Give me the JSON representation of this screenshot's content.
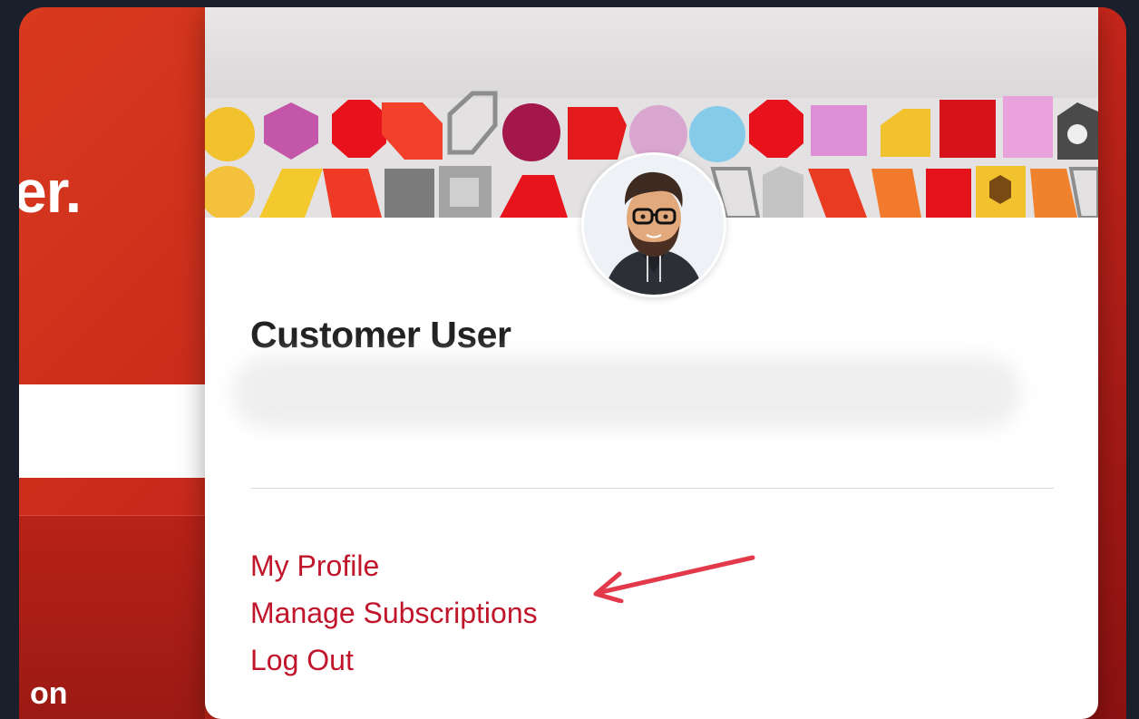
{
  "background": {
    "heading_fragment": "er.",
    "footer_fragment": "on"
  },
  "profile": {
    "name": "Customer User"
  },
  "menu": {
    "items": [
      {
        "label": "My Profile"
      },
      {
        "label": "Manage Subscriptions"
      },
      {
        "label": "Log Out"
      }
    ]
  },
  "annotation": {
    "type": "arrow",
    "target": "Manage Subscriptions",
    "color": "#e23a4a"
  },
  "colors": {
    "brand_red": "#c0152a",
    "page_bg": "#1a1f2c"
  }
}
